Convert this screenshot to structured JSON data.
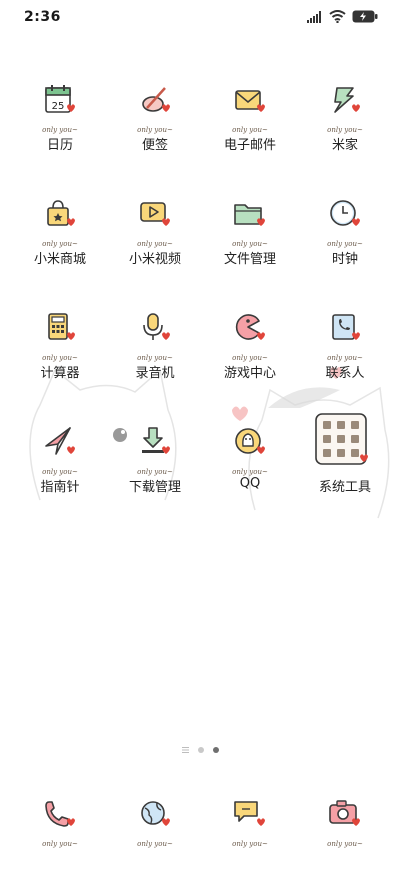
{
  "status": {
    "time": "2:36"
  },
  "tag_text": "only you~",
  "rows": [
    [
      {
        "label": "日历",
        "icon": "calendar-icon",
        "day": "25"
      },
      {
        "label": "便签",
        "icon": "notes-icon"
      },
      {
        "label": "电子邮件",
        "icon": "email-icon"
      },
      {
        "label": "米家",
        "icon": "mijia-icon"
      }
    ],
    [
      {
        "label": "小米商城",
        "icon": "shopping-bag-icon"
      },
      {
        "label": "小米视频",
        "icon": "video-icon"
      },
      {
        "label": "文件管理",
        "icon": "folder-icon"
      },
      {
        "label": "时钟",
        "icon": "clock-icon"
      }
    ],
    [
      {
        "label": "计算器",
        "icon": "calculator-icon"
      },
      {
        "label": "录音机",
        "icon": "microphone-icon"
      },
      {
        "label": "游戏中心",
        "icon": "game-icon"
      },
      {
        "label": "联系人",
        "icon": "contacts-icon"
      }
    ],
    [
      {
        "label": "指南针",
        "icon": "compass-icon"
      },
      {
        "label": "下载管理",
        "icon": "download-icon"
      },
      {
        "label": "QQ",
        "icon": "qq-icon"
      },
      {
        "label": "系统工具",
        "icon": "system-tools-folder-icon"
      }
    ]
  ],
  "dock": [
    {
      "icon": "phone-icon"
    },
    {
      "icon": "browser-icon"
    },
    {
      "icon": "messages-icon"
    },
    {
      "icon": "camera-icon"
    }
  ],
  "pages": {
    "count": 3,
    "active": 2
  }
}
